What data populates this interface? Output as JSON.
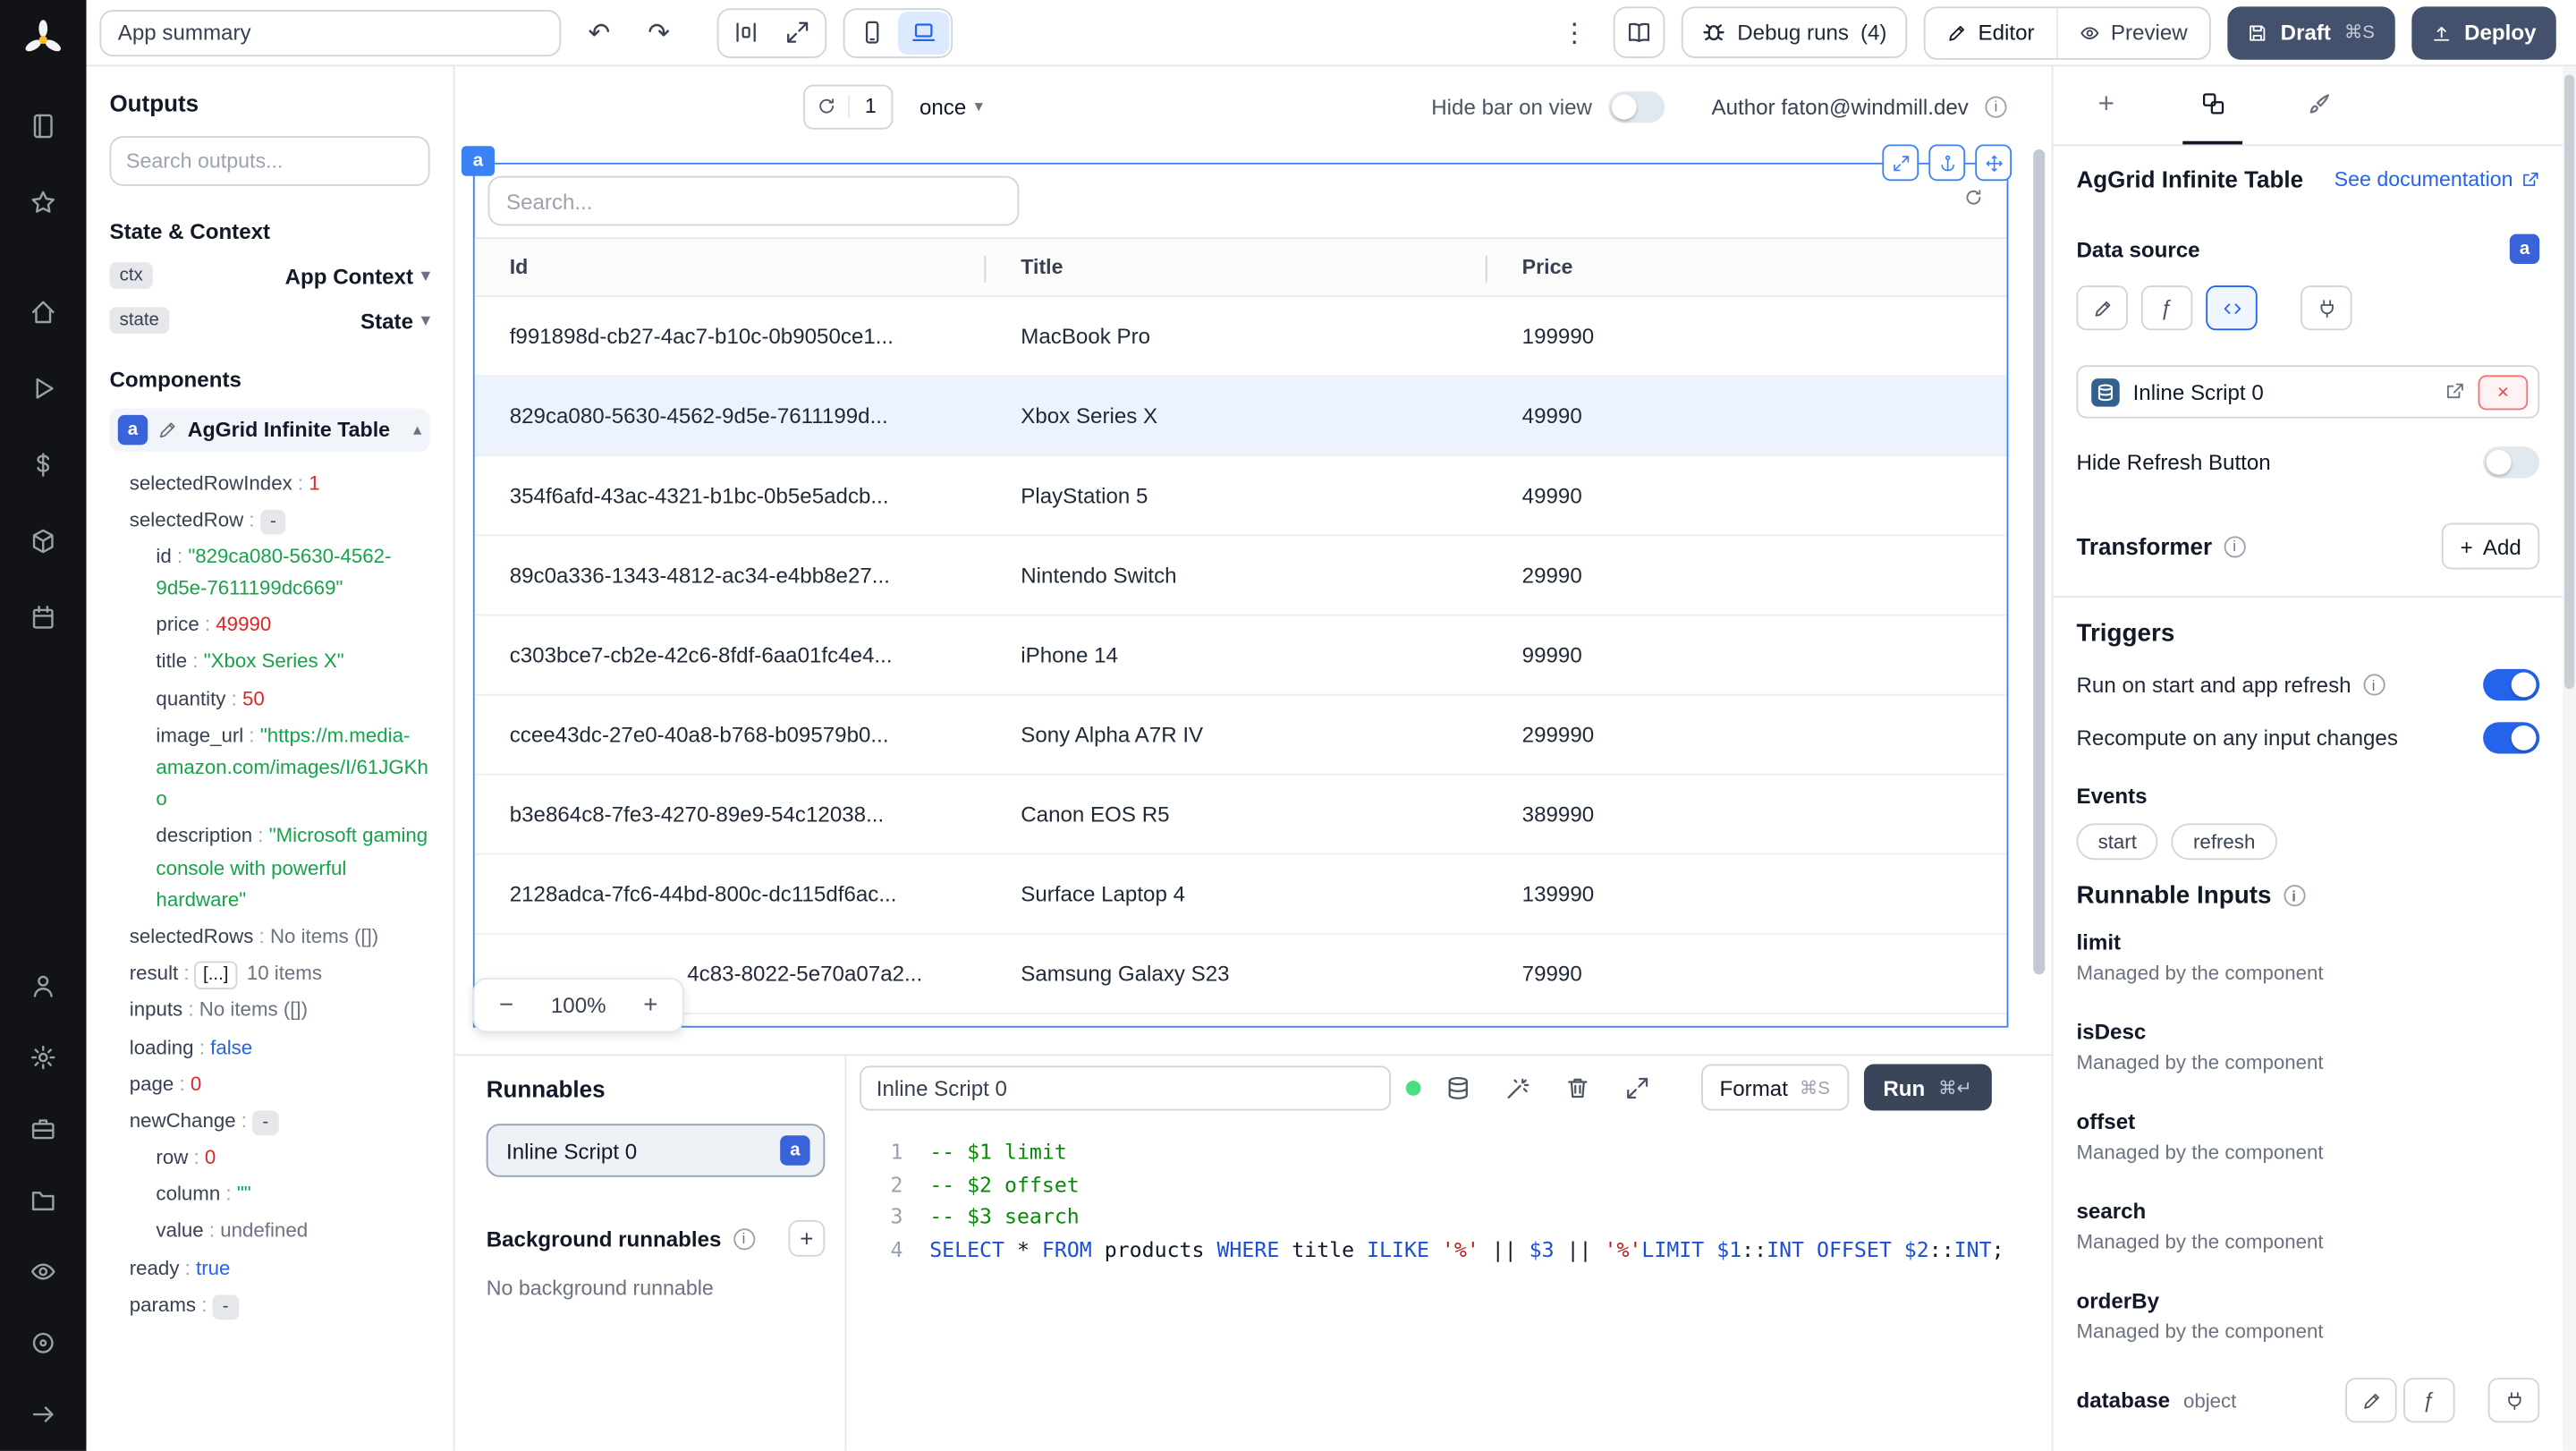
{
  "colors": {
    "accent": "#2563eb",
    "badge": "#3b63d9",
    "dark_button": "#44516c",
    "toggle_on": "#2563eb",
    "run_green": "#4ade80",
    "selected_row": "#ecf3fe"
  },
  "icons": {
    "undo": "↶",
    "redo": "↷",
    "dots": "⋮",
    "chevron_down": "▾",
    "chevron_up": "▴",
    "plus": "+",
    "minus": "−",
    "close": "×",
    "fx": "ƒ",
    "code_glyph": "</>"
  },
  "rail": {
    "top": [
      {
        "name": "notebook-icon",
        "ref": "#i-notebook"
      },
      {
        "name": "star-icon",
        "ref": "#i-star"
      }
    ],
    "mid": [
      {
        "name": "home-icon",
        "ref": "#i-home"
      },
      {
        "name": "runs-play-icon",
        "ref": "#i-play"
      },
      {
        "name": "variables-dollar-icon",
        "ref": "#i-dollar"
      },
      {
        "name": "resources-package-icon",
        "ref": "#i-cube"
      },
      {
        "name": "schedules-calendar-icon",
        "ref": "#i-calendar"
      }
    ],
    "bottom": [
      {
        "name": "user-icon",
        "ref": "#i-person"
      },
      {
        "name": "settings-gear-icon",
        "ref": "#i-gear"
      },
      {
        "name": "workspace-briefcase-icon",
        "ref": "#i-briefcase"
      },
      {
        "name": "folder-icon",
        "ref": "#i-folder"
      },
      {
        "name": "eye-icon",
        "ref": "#i-eye"
      },
      {
        "name": "target-icon",
        "ref": "#i-scan"
      },
      {
        "name": "collapse-arrow-icon",
        "ref": "#i-arrow"
      }
    ]
  },
  "topbar": {
    "app_summary": "App summary",
    "debug_runs": "Debug runs",
    "debug_count": "(4)",
    "editor": "Editor",
    "preview": "Preview",
    "draft": "Draft",
    "draft_kbd": "⌘S",
    "deploy": "Deploy"
  },
  "canvas_bar": {
    "refresh_count": "1",
    "interval": "once",
    "hide_bar": "Hide bar on view",
    "author": "Author faton@windmill.dev"
  },
  "outputs": {
    "title": "Outputs",
    "search_placeholder": "Search outputs...",
    "state_context": "State & Context",
    "ctx_badge": "ctx",
    "ctx_label": "App Context",
    "state_badge": "state",
    "state_label": "State",
    "components": "Components",
    "component_badge": "a",
    "component_name": "AgGrid Infinite Table",
    "tree": [
      {
        "key": "selectedRowIndex",
        "value": "1",
        "type": "num",
        "indent": 0
      },
      {
        "key": "selectedRow",
        "value": "-",
        "type": "badge",
        "indent": 0
      },
      {
        "key": "id",
        "value": "\"829ca080-5630-4562-9d5e-7611199dc669\"",
        "type": "str",
        "indent": 1
      },
      {
        "key": "price",
        "value": "49990",
        "type": "num",
        "indent": 1
      },
      {
        "key": "title",
        "value": "\"Xbox Series X\"",
        "type": "str",
        "indent": 1
      },
      {
        "key": "quantity",
        "value": "50",
        "type": "num",
        "indent": 1
      },
      {
        "key": "image_url",
        "value": "\"https://m.media-amazon.com/images/I/61JGKho",
        "type": "str",
        "indent": 1
      },
      {
        "key": "description",
        "value": "\"Microsoft gaming console with powerful hardware\"",
        "type": "str",
        "indent": 1
      },
      {
        "key": "selectedRows",
        "value": "No items ([])",
        "type": "muted",
        "indent": 0
      },
      {
        "key": "result",
        "value": "10 items",
        "type": "items",
        "indent": 0
      },
      {
        "key": "inputs",
        "value": "No items ([])",
        "type": "muted",
        "indent": 0
      },
      {
        "key": "loading",
        "value": "false",
        "type": "bool",
        "indent": 0
      },
      {
        "key": "page",
        "value": "0",
        "type": "num",
        "indent": 0
      },
      {
        "key": "newChange",
        "value": "-",
        "type": "badge",
        "indent": 0
      },
      {
        "key": "row",
        "value": "0",
        "type": "num",
        "indent": 1
      },
      {
        "key": "column",
        "value": "\"\"",
        "type": "str",
        "indent": 1
      },
      {
        "key": "value",
        "value": "undefined",
        "type": "muted",
        "indent": 1
      },
      {
        "key": "ready",
        "value": "true",
        "type": "bool",
        "indent": 0
      },
      {
        "key": "params",
        "value": "-",
        "type": "badge",
        "indent": 0
      }
    ]
  },
  "grid": {
    "badge": "a",
    "search_placeholder": "Search...",
    "columns": [
      "Id",
      "Title",
      "Price"
    ],
    "rows": [
      {
        "id": "f991898d-cb27-4ac7-b10c-0b9050ce1...",
        "title": "MacBook Pro",
        "price": "199990"
      },
      {
        "id": "829ca080-5630-4562-9d5e-7611199d...",
        "title": "Xbox Series X",
        "price": "49990",
        "selected": true
      },
      {
        "id": "354f6afd-43ac-4321-b1bc-0b5e5adcb...",
        "title": "PlayStation 5",
        "price": "49990"
      },
      {
        "id": "89c0a336-1343-4812-ac34-e4bb8e27...",
        "title": "Nintendo Switch",
        "price": "29990"
      },
      {
        "id": "c303bce7-cb2e-42c6-8fdf-6aa01fc4e4...",
        "title": "iPhone 14",
        "price": "99990"
      },
      {
        "id": "ccee43dc-27e0-40a8-b768-b09579b0...",
        "title": "Sony Alpha A7R IV",
        "price": "299990"
      },
      {
        "id": "b3e864c8-7fe3-4270-89e9-54c12038...",
        "title": "Canon EOS R5",
        "price": "389990"
      },
      {
        "id": "2128adca-7fc6-44bd-800c-dc115df6ac...",
        "title": "Surface Laptop 4",
        "price": "139990"
      },
      {
        "id": "4c83-8022-5e70a07a2...",
        "title": "Samsung Galaxy S23",
        "price": "79990",
        "cut": true
      }
    ],
    "zoom": "100%"
  },
  "runnables": {
    "title": "Runnables",
    "items": [
      {
        "label": "Inline Script 0",
        "badge": "a"
      }
    ],
    "background_title": "Background runnables",
    "background_empty": "No background runnable"
  },
  "editor": {
    "name": "Inline Script 0",
    "format": "Format",
    "format_kbd": "⌘S",
    "run": "Run",
    "run_kbd": "⌘↵",
    "lines": [
      [
        {
          "t": "-- $1 limit",
          "c": "com"
        }
      ],
      [
        {
          "t": "-- $2 offset",
          "c": "com"
        }
      ],
      [
        {
          "t": "-- $3 search",
          "c": "com"
        }
      ],
      [
        {
          "t": "SELECT",
          "c": "kw"
        },
        {
          "t": " ",
          "c": "pl"
        },
        {
          "t": "*",
          "c": "pl"
        },
        {
          "t": " ",
          "c": "pl"
        },
        {
          "t": "FROM",
          "c": "kw"
        },
        {
          "t": " products ",
          "c": "pl"
        },
        {
          "t": "WHERE",
          "c": "kw"
        },
        {
          "t": " title ",
          "c": "pl"
        },
        {
          "t": "ILIKE",
          "c": "kw"
        },
        {
          "t": " ",
          "c": "pl"
        },
        {
          "t": "'%'",
          "c": "str"
        },
        {
          "t": " || ",
          "c": "pl"
        },
        {
          "t": "$3",
          "c": "var"
        },
        {
          "t": " || ",
          "c": "pl"
        },
        {
          "t": "'%'",
          "c": "str"
        },
        {
          "t": "LIMIT",
          "c": "kw"
        },
        {
          "t": " ",
          "c": "pl"
        },
        {
          "t": "$1",
          "c": "var"
        },
        {
          "t": "::",
          "c": "pl"
        },
        {
          "t": "INT",
          "c": "kw"
        },
        {
          "t": " ",
          "c": "pl"
        },
        {
          "t": "OFFSET",
          "c": "kw"
        },
        {
          "t": " ",
          "c": "pl"
        },
        {
          "t": "$2",
          "c": "var"
        },
        {
          "t": "::",
          "c": "pl"
        },
        {
          "t": "INT",
          "c": "kw"
        },
        {
          "t": ";",
          "c": "pl"
        }
      ]
    ]
  },
  "panel": {
    "component_title": "AgGrid Infinite Table",
    "see_docs": "See documentation",
    "data_source": "Data source",
    "badge": "a",
    "script_name": "Inline Script 0",
    "hide_refresh": "Hide Refresh Button",
    "transformer": "Transformer",
    "add": "Add",
    "triggers": "Triggers",
    "run_on_start": "Run on start and app refresh",
    "recompute": "Recompute on any input changes",
    "events": "Events",
    "event_chips": [
      "start",
      "refresh"
    ],
    "runnable_inputs": "Runnable Inputs",
    "inputs": [
      {
        "name": "limit",
        "desc": "Managed by the component"
      },
      {
        "name": "isDesc",
        "desc": "Managed by the component"
      },
      {
        "name": "offset",
        "desc": "Managed by the component"
      },
      {
        "name": "search",
        "desc": "Managed by the component"
      },
      {
        "name": "orderBy",
        "desc": "Managed by the component"
      }
    ],
    "database_label": "database",
    "database_type": "object"
  },
  "toggles": {
    "hide_bar_on_view": false,
    "hide_refresh_button": false,
    "run_on_start": true,
    "recompute": true
  }
}
